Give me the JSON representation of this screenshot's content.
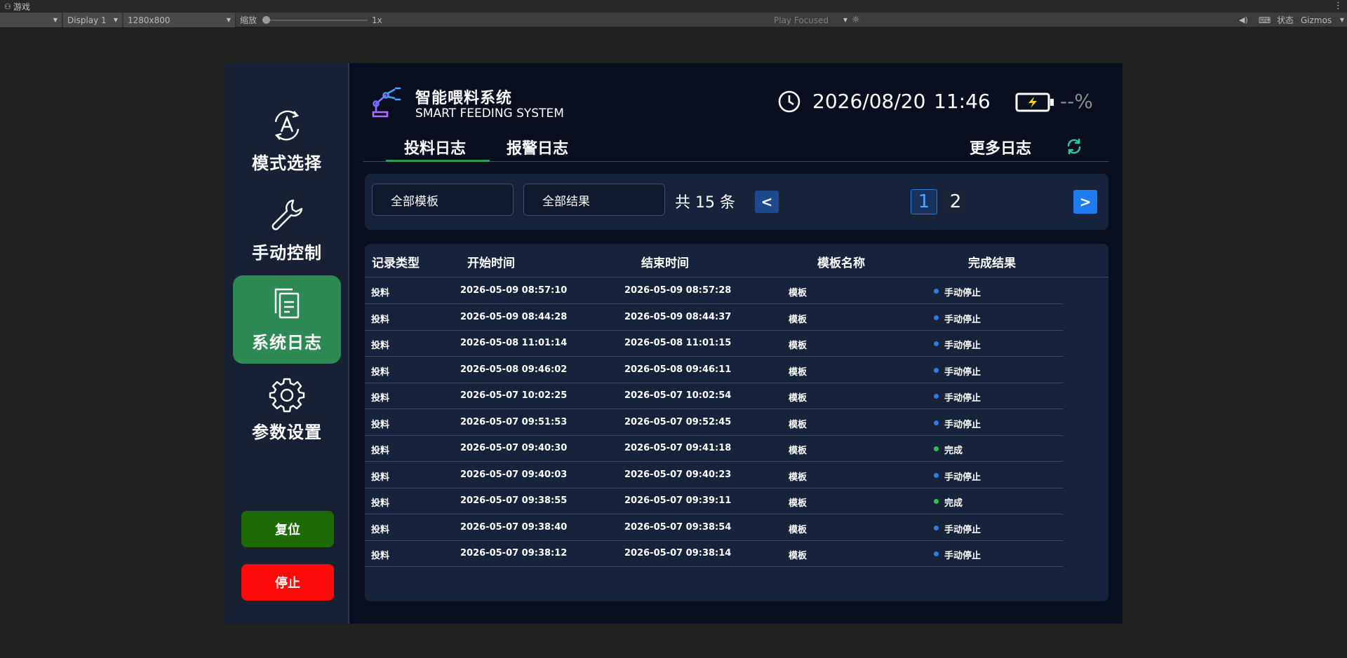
{
  "editor": {
    "window_title": "游戏",
    "display": "Display 1",
    "resolution": "1280x800",
    "scale_label": "缩放",
    "scale_value": "1x",
    "play_mode": "Play Focused",
    "stats_label": "状态",
    "gizmos_label": "Gizmos"
  },
  "app": {
    "title_cn": "智能喂料系统",
    "title_en": "SMART FEEDING SYSTEM",
    "date": "2026/08/20",
    "time": "11:46",
    "battery": "--%"
  },
  "nav": [
    {
      "label": "模式选择",
      "icon": "auto-mode-icon",
      "active": false
    },
    {
      "label": "手动控制",
      "icon": "wrench-icon",
      "active": false
    },
    {
      "label": "系统日志",
      "icon": "documents-icon",
      "active": true
    },
    {
      "label": "参数设置",
      "icon": "gear-icon",
      "active": false
    }
  ],
  "actions": {
    "reset": "复位",
    "stop": "停止"
  },
  "tabs": {
    "feed_log": "投料日志",
    "alarm_log": "报警日志",
    "more_logs": "更多日志"
  },
  "filters": {
    "template_select": "全部模板",
    "result_select": "全部结果",
    "total": "共 15 条",
    "prev": "<",
    "next": ">",
    "pages": [
      "1",
      "2"
    ],
    "current_page": 1
  },
  "table": {
    "headers": [
      "记录类型",
      "开始时间",
      "结束时间",
      "模板名称",
      "完成结果"
    ],
    "rows": [
      {
        "type": "投料",
        "start": "2026-05-09 08:57:10",
        "end": "2026-05-09 08:57:28",
        "template": "模板",
        "result": "手动停止",
        "status": "stopped"
      },
      {
        "type": "投料",
        "start": "2026-05-09 08:44:28",
        "end": "2026-05-09 08:44:37",
        "template": "模板",
        "result": "手动停止",
        "status": "stopped"
      },
      {
        "type": "投料",
        "start": "2026-05-08 11:01:14",
        "end": "2026-05-08 11:01:15",
        "template": "模板",
        "result": "手动停止",
        "status": "stopped"
      },
      {
        "type": "投料",
        "start": "2026-05-08 09:46:02",
        "end": "2026-05-08 09:46:11",
        "template": "模板",
        "result": "手动停止",
        "status": "stopped"
      },
      {
        "type": "投料",
        "start": "2026-05-07 10:02:25",
        "end": "2026-05-07 10:02:54",
        "template": "模板",
        "result": "手动停止",
        "status": "stopped"
      },
      {
        "type": "投料",
        "start": "2026-05-07 09:51:53",
        "end": "2026-05-07 09:52:45",
        "template": "模板",
        "result": "手动停止",
        "status": "stopped"
      },
      {
        "type": "投料",
        "start": "2026-05-07 09:40:30",
        "end": "2026-05-07 09:41:18",
        "template": "模板",
        "result": "完成",
        "status": "done"
      },
      {
        "type": "投料",
        "start": "2026-05-07 09:40:03",
        "end": "2026-05-07 09:40:23",
        "template": "模板",
        "result": "手动停止",
        "status": "stopped"
      },
      {
        "type": "投料",
        "start": "2026-05-07 09:38:55",
        "end": "2026-05-07 09:39:11",
        "template": "模板",
        "result": "完成",
        "status": "done"
      },
      {
        "type": "投料",
        "start": "2026-05-07 09:38:40",
        "end": "2026-05-07 09:38:54",
        "template": "模板",
        "result": "手动停止",
        "status": "stopped"
      },
      {
        "type": "投料",
        "start": "2026-05-07 09:38:12",
        "end": "2026-05-07 09:38:14",
        "template": "模板",
        "result": "手动停止",
        "status": "stopped"
      }
    ]
  },
  "colors": {
    "stopped": "#2f7ce8",
    "done": "#2ec24a",
    "active_nav": "#2e8a55",
    "reset": "#1d6b07",
    "stop": "#ff0a0a",
    "accent": "#1f7cf0"
  }
}
